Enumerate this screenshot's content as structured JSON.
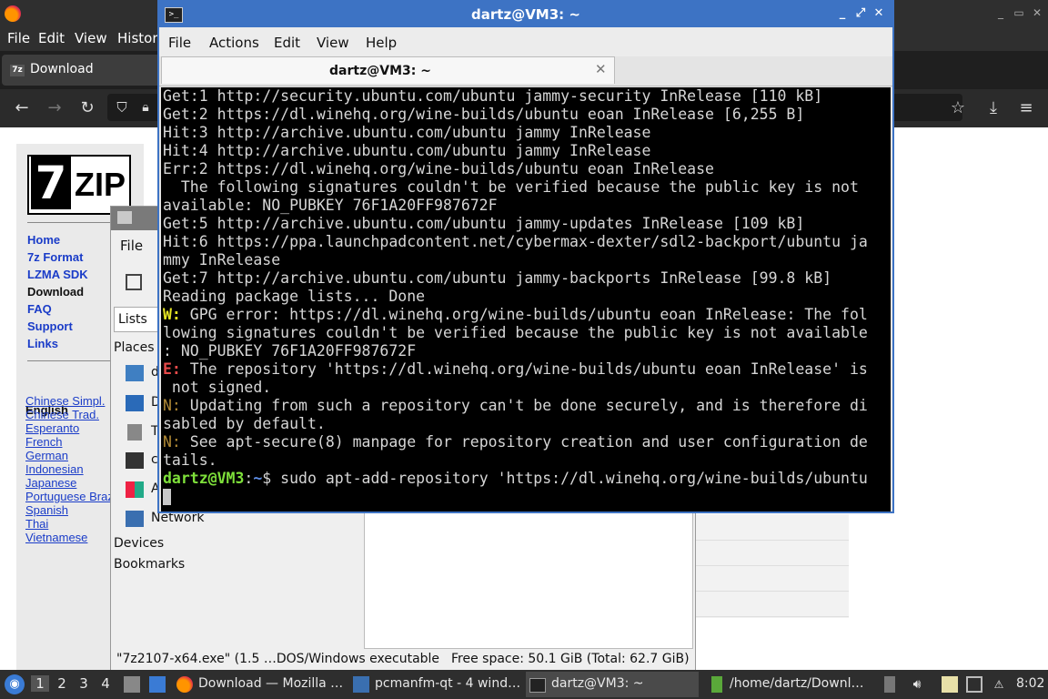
{
  "firefox": {
    "menu": [
      "File",
      "Edit",
      "View",
      "History"
    ],
    "tab_label": "Download",
    "tab_icon_text": "7z",
    "icons": [
      "firefox-logo-icon",
      "back-icon",
      "forward-icon",
      "reload-icon",
      "shield-icon",
      "lock-icon",
      "bookmark-star-icon",
      "download-icon",
      "hamburger-menu-icon"
    ],
    "window_buttons": [
      "_",
      "▭",
      "✕"
    ]
  },
  "sevenzip": {
    "logo_number": "7",
    "logo_text": "ZIP",
    "nav": [
      "Home",
      "7z Format",
      "LZMA SDK",
      "Download",
      "FAQ",
      "Support",
      "Links"
    ],
    "current_nav": "Download",
    "current_language": "English",
    "languages": [
      "Chinese Simpl.",
      "Chinese Trad.",
      "Esperanto",
      "French",
      "German",
      "Indonesian",
      "Japanese",
      "Portuguese Brazil",
      "Spanish",
      "Thai",
      "Vietnamese"
    ]
  },
  "pcmanfm": {
    "menu_file": "File",
    "lists_label": "Lists",
    "places_header": "Places",
    "places": [
      {
        "label": "d",
        "icon": "home-folder-icon"
      },
      {
        "label": "D",
        "icon": "desktop-icon"
      },
      {
        "label": "T",
        "icon": "trash-icon"
      },
      {
        "label": "c",
        "icon": "computer-icon"
      },
      {
        "label": "A",
        "icon": "applications-icon"
      },
      {
        "label": "Network",
        "icon": "network-icon"
      }
    ],
    "devices_header": "Devices",
    "bookmarks_header": "Bookmarks",
    "status_file": "\"7z2107-x64.exe\" (1.5 …DOS/Windows executable",
    "status_free": "Free space: 50.1 GiB (Total: 62.7 GiB)"
  },
  "terminal": {
    "title": "dartz@VM3: ~",
    "menu": [
      "File",
      "Actions",
      "Edit",
      "View",
      "Help"
    ],
    "tab_title": "dartz@VM3: ~",
    "lines": [
      "Get:1 http://security.ubuntu.com/ubuntu jammy-security InRelease [110 kB]",
      "Get:2 https://dl.winehq.org/wine-builds/ubuntu eoan InRelease [6,255 B]",
      "Hit:3 http://archive.ubuntu.com/ubuntu jammy InRelease",
      "Hit:4 http://archive.ubuntu.com/ubuntu jammy InRelease",
      "Err:2 https://dl.winehq.org/wine-builds/ubuntu eoan InRelease",
      "  The following signatures couldn't be verified because the public key is not",
      "available: NO_PUBKEY 76F1A20FF987672F",
      "Get:5 http://archive.ubuntu.com/ubuntu jammy-updates InRelease [109 kB]",
      "Hit:6 https://ppa.launchpadcontent.net/cybermax-dexter/sdl2-backport/ubuntu ja",
      "mmy InRelease",
      "Get:7 http://archive.ubuntu.com/ubuntu jammy-backports InRelease [99.8 kB]",
      "Reading package lists... Done"
    ],
    "warn_prefix": "W:",
    "warn_text": " GPG error: https://dl.winehq.org/wine-builds/ubuntu eoan InRelease: The fol\nlowing signatures couldn't be verified because the public key is not available\n: NO_PUBKEY 76F1A20FF987672F",
    "err_prefix": "E:",
    "err_text": " The repository 'https://dl.winehq.org/wine-builds/ubuntu eoan InRelease' is\n not signed.",
    "note1_prefix": "N:",
    "note1_text": " Updating from such a repository can't be done securely, and is therefore di\nsabled by default.",
    "note2_prefix": "N:",
    "note2_text": " See apt-secure(8) manpage for repository creation and user configuration de\ntails.",
    "prompt_user": "dartz@VM3",
    "prompt_sep": ":",
    "prompt_path": "~",
    "prompt_symbol": "$ ",
    "command": "sudo apt-add-repository 'https://dl.winehq.org/wine-builds/ubuntu"
  },
  "taskbar": {
    "desktops": [
      "1",
      "2",
      "3",
      "4"
    ],
    "active_desktop": "1",
    "tasks": [
      {
        "label": "Download — Mozilla …",
        "icon": "firefox-icon"
      },
      {
        "label": "pcmanfm-qt - 4 wind…",
        "icon": "folder-icon"
      },
      {
        "label": "dartz@VM3: ~",
        "icon": "terminal-icon"
      },
      {
        "label": "/home/dartz/Downl…",
        "icon": "file-icon"
      }
    ],
    "clock": "8:02",
    "colors": {
      "accent": "#3d73c4",
      "prompt": "#7ee03a",
      "warning": "#e6e624",
      "error": "#e84a4a",
      "note": "#b28a35"
    }
  }
}
